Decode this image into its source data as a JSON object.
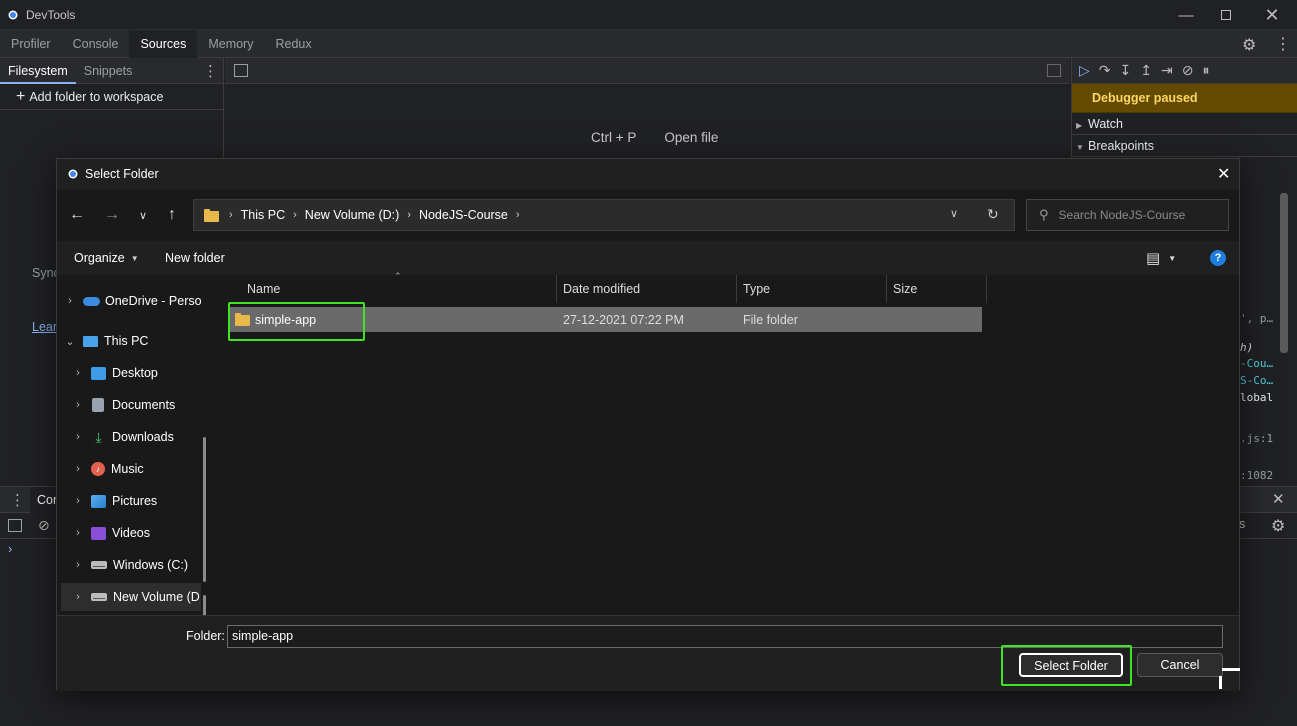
{
  "devtools": {
    "window_title": "DevTools",
    "main_tabs": [
      {
        "label": "Profiler"
      },
      {
        "label": "Console"
      },
      {
        "label": "Sources"
      },
      {
        "label": "Memory"
      },
      {
        "label": "Redux"
      }
    ],
    "active_tab": "Sources",
    "navigator": {
      "tabs": [
        {
          "label": "Filesystem"
        },
        {
          "label": "Snippets"
        }
      ],
      "add_folder_label": "Add folder to workspace",
      "sync_fragment": "Sync",
      "learn_fragment": "Lear"
    },
    "editor": {
      "shortcut_key": "Ctrl + P",
      "shortcut_action": "Open file"
    },
    "debugger": {
      "paused_label": "Debugger paused",
      "sections": [
        {
          "label": "Watch"
        },
        {
          "label": "Breakpoints"
        }
      ],
      "code_fragments": [
        {
          "text": "', p…",
          "color": "#9aa0a6"
        },
        {
          "text": "h)",
          "color": "#e8eaed"
        },
        {
          "text": "-Cou…",
          "color": "#4dd0e1"
        },
        {
          "text": "S-Co…",
          "color": "#4dd0e1"
        },
        {
          "text": "lobal",
          "color": "#e8eaed"
        },
        {
          "text": ".js:1",
          "color": "#9aa0a6"
        },
        {
          "text": ":1082",
          "color": "#9aa0a6"
        }
      ]
    },
    "drawer": {
      "tab_fragment": "Cor",
      "right_fragment": "s"
    }
  },
  "dialog": {
    "title": "Select Folder",
    "breadcrumb": [
      "This PC",
      "New Volume (D:)",
      "NodeJS-Course"
    ],
    "search_placeholder": "Search NodeJS-Course",
    "organize_label": "Organize",
    "new_folder_label": "New folder",
    "tree": [
      {
        "label": "OneDrive - Perso",
        "icon": "cloud-icon",
        "expanded": false
      },
      {
        "label": "This PC",
        "icon": "computer-icon",
        "expanded": true
      },
      {
        "label": "Desktop",
        "icon": "desktop-folder-icon",
        "expanded": false
      },
      {
        "label": "Documents",
        "icon": "documents-icon",
        "expanded": false
      },
      {
        "label": "Downloads",
        "icon": "download-icon",
        "expanded": false
      },
      {
        "label": "Music",
        "icon": "music-icon",
        "expanded": false
      },
      {
        "label": "Pictures",
        "icon": "pictures-icon",
        "expanded": false
      },
      {
        "label": "Videos",
        "icon": "videos-icon",
        "expanded": false
      },
      {
        "label": "Windows (C:)",
        "icon": "drive-icon",
        "expanded": false
      },
      {
        "label": "New Volume (D",
        "icon": "drive-icon",
        "expanded": false
      }
    ],
    "columns": [
      "Name",
      "Date modified",
      "Type",
      "Size"
    ],
    "files": [
      {
        "name": "simple-app",
        "date_modified": "27-12-2021 07:22 PM",
        "type": "File folder",
        "size": ""
      }
    ],
    "folder_label": "Folder:",
    "folder_value": "simple-app",
    "select_button": "Select Folder",
    "cancel_button": "Cancel"
  },
  "colors": {
    "highlight": "#3ee41d",
    "paused_banner": "#624b00",
    "paused_text": "#fdd663",
    "accent_blue": "#8ab4f8"
  }
}
